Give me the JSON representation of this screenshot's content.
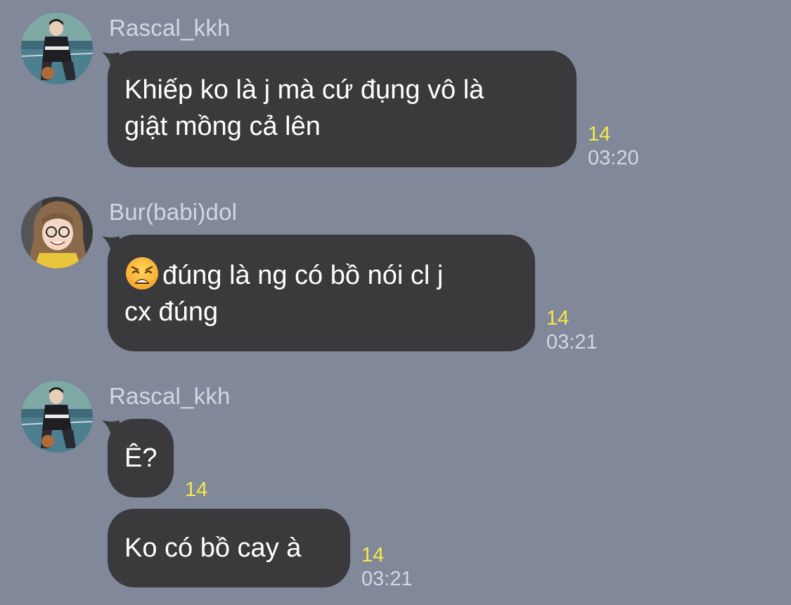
{
  "colors": {
    "background": "#808899",
    "bubble": "#3a3a3c",
    "bubble_text": "#ffffff",
    "sender_name": "#d2d7e2",
    "unread_count": "#f7e84a",
    "timestamp": "#d2d7e2"
  },
  "messages": [
    {
      "sender": "Rascal_kkh",
      "avatar_icon": "user-avatar-icon",
      "lines": [
        "Khiếp ko là j mà cứ đụng vô là",
        "giật mồng cả lên"
      ],
      "unread": "14",
      "time": "03:20"
    },
    {
      "sender": "Bur(babi)dol",
      "avatar_icon": "user-avatar-icon",
      "emoji": "weary-face-emoji",
      "lines": [
        "đúng là ng có bồ nói cl j",
        "cx đúng"
      ],
      "unread": "14",
      "time": "03:21"
    },
    {
      "sender": "Rascal_kkh",
      "avatar_icon": "user-avatar-icon",
      "lines": [
        "Ê?"
      ],
      "unread": "14"
    },
    {
      "lines": [
        "Ko có bồ cay à"
      ],
      "unread": "14",
      "time": "03:21"
    }
  ]
}
